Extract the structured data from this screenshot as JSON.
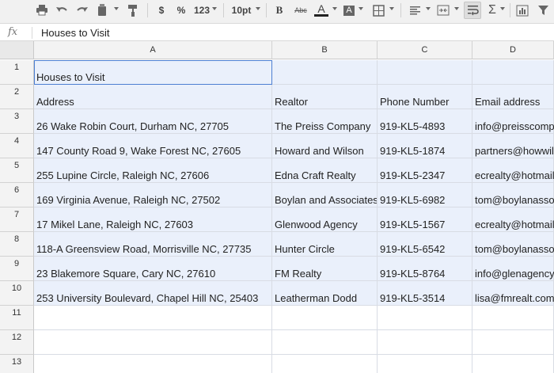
{
  "toolbar": {
    "currency": "$",
    "percent": "%",
    "number_format": "123",
    "font_size": "10pt",
    "bold": "B",
    "strikethrough": "Abc",
    "text_color_label": "A",
    "fill_color_label": "A",
    "icons": [
      "print-icon",
      "undo-icon",
      "redo-icon",
      "paint-bucket-icon",
      "paint-format-icon",
      "borders-icon",
      "align-left-icon",
      "merge-cells-icon",
      "wrap-text-icon",
      "sum-icon",
      "chart-icon",
      "filter-icon"
    ],
    "accent": "#222222"
  },
  "formula_bar": {
    "fx_label": "fx",
    "value": "Houses to Visit"
  },
  "columns": [
    "A",
    "B",
    "C",
    "D"
  ],
  "rows": [
    {
      "num": "1",
      "a": "Houses to Visit",
      "b": "",
      "c": "",
      "d": ""
    },
    {
      "num": "2",
      "a": "Address",
      "b": "Realtor",
      "c": "Phone Number",
      "d": "Email address"
    },
    {
      "num": "3",
      "a": "26 Wake Robin Court, Durham NC, 27705",
      "b": "The Preiss Company",
      "c": "919-KL5-4893",
      "d": "info@preisscomp"
    },
    {
      "num": "4",
      "a": "147 County Road 9, Wake Forest NC, 27605",
      "b": "Howard and Wilson",
      "c": "919-KL5-1874",
      "d": "partners@howwil"
    },
    {
      "num": "5",
      "a": "255 Lupine Circle, Raleigh NC, 27606",
      "b": "Edna Craft Realty",
      "c": "919-KL5-2347",
      "d": "ecrealty@hotmail"
    },
    {
      "num": "6",
      "a": "169 Virginia Avenue, Raleigh NC, 27502",
      "b": "Boylan and Associates",
      "c": "919-KL5-6982",
      "d": "tom@boylanasso"
    },
    {
      "num": "7",
      "a": "17 Mikel Lane, Raleigh NC, 27603",
      "b": "Glenwood Agency",
      "c": "919-KL5-1567",
      "d": "ecrealty@hotmail"
    },
    {
      "num": "8",
      "a": "118-A Greensview Road, Morrisville NC, 27735",
      "b": "Hunter Circle",
      "c": "919-KL5-6542",
      "d": "tom@boylanasso"
    },
    {
      "num": "9",
      "a": "23 Blakemore Square, Cary NC, 27610",
      "b": "FM Realty",
      "c": "919-KL5-8764",
      "d": "info@glenagency"
    },
    {
      "num": "10",
      "a": "253 University Boulevard, Chapel Hill NC, 25403",
      "b": "Leatherman Dodd",
      "c": "919-KL5-3514",
      "d": "lisa@fmrealt.com"
    },
    {
      "num": "11",
      "a": "",
      "b": "",
      "c": "",
      "d": ""
    },
    {
      "num": "12",
      "a": "",
      "b": "",
      "c": "",
      "d": ""
    },
    {
      "num": "13",
      "a": "",
      "b": "",
      "c": "",
      "d": ""
    }
  ]
}
